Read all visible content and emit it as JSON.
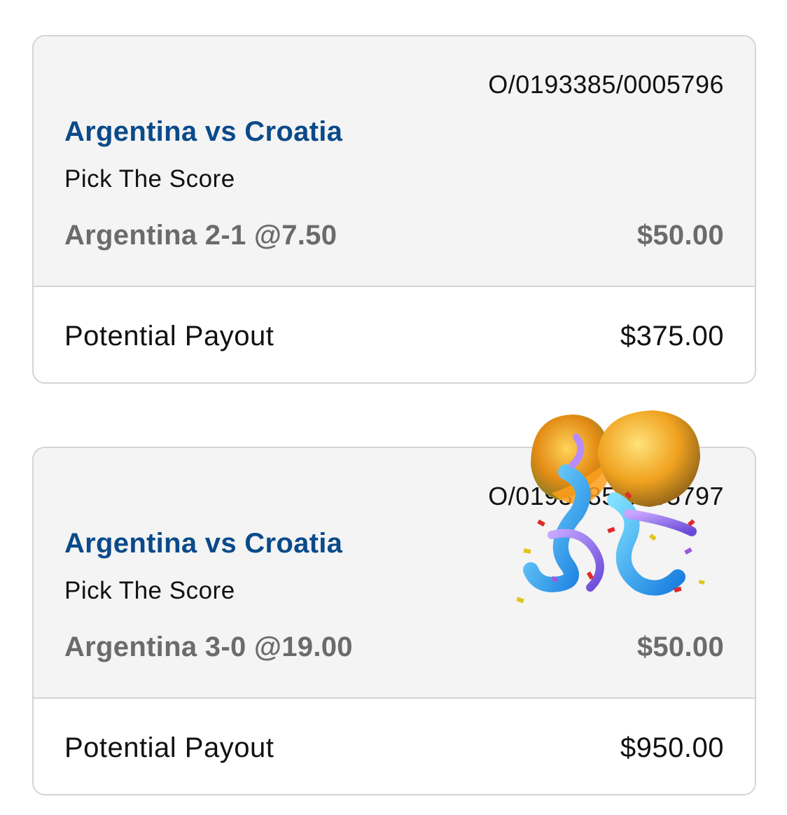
{
  "bets": [
    {
      "ticket_ref": "O/0193385/0005796",
      "match": "Argentina vs Croatia",
      "market": "Pick The Score",
      "selection": "Argentina 2-1 @7.50",
      "stake": "$50.00",
      "payout_label": "Potential Payout",
      "payout_value": "$375.00"
    },
    {
      "ticket_ref": "O/0193385/0005797",
      "match": "Argentina vs Croatia",
      "market": "Pick The Score",
      "selection": "Argentina 3-0 @19.00",
      "stake": "$50.00",
      "payout_label": "Potential Payout",
      "payout_value": "$950.00"
    }
  ],
  "overlay": {
    "icon": "confetti-ball-icon"
  },
  "colors": {
    "match_title": "#0a4a8a",
    "selection": "#6b6b6b",
    "card_header_bg": "#f4f4f4",
    "border": "#d4d4d4"
  }
}
